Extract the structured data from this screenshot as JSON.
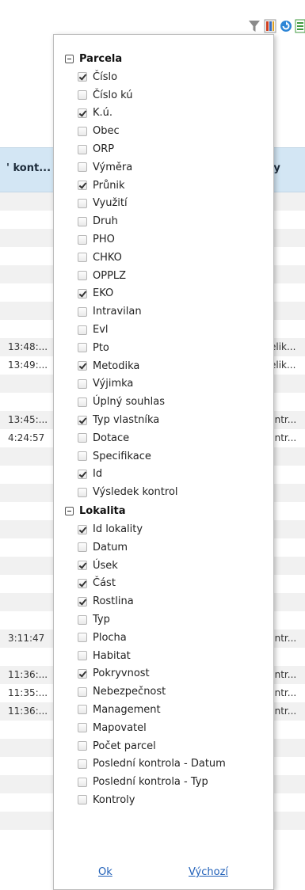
{
  "toolbar": {
    "icons": [
      "filter-icon",
      "columns-icon",
      "refresh-icon",
      "export-icon"
    ]
  },
  "table": {
    "header_left": "' kont...",
    "header_right": "oly",
    "rows": [
      {
        "left": "",
        "right": ""
      },
      {
        "left": "",
        "right": ""
      },
      {
        "left": "",
        "right": ""
      },
      {
        "left": "",
        "right": ""
      },
      {
        "left": "",
        "right": ""
      },
      {
        "left": "",
        "right": ""
      },
      {
        "left": "",
        "right": ""
      },
      {
        "left": "",
        "right": ""
      },
      {
        "left": "13:48:...",
        "right": "Nelik..."
      },
      {
        "left": "13:49:...",
        "right": "Nelik..."
      },
      {
        "left": "",
        "right": ""
      },
      {
        "left": "",
        "right": ""
      },
      {
        "left": "13:45:...",
        "right": "Kontr..."
      },
      {
        "left": "4:24:57",
        "right": "Kontr..."
      },
      {
        "left": "",
        "right": ""
      },
      {
        "left": "",
        "right": ""
      },
      {
        "left": "",
        "right": ""
      },
      {
        "left": "",
        "right": ""
      },
      {
        "left": "",
        "right": ""
      },
      {
        "left": "",
        "right": ""
      },
      {
        "left": "",
        "right": ""
      },
      {
        "left": "",
        "right": ""
      },
      {
        "left": "",
        "right": ""
      },
      {
        "left": "",
        "right": ""
      },
      {
        "left": "3:11:47",
        "right": "Kontr..."
      },
      {
        "left": "",
        "right": ""
      },
      {
        "left": "11:36:...",
        "right": "Kontr..."
      },
      {
        "left": "11:35:...",
        "right": "Kontr..."
      },
      {
        "left": "11:36:...",
        "right": "Kontr..."
      },
      {
        "left": "",
        "right": ""
      },
      {
        "left": "",
        "right": ""
      },
      {
        "left": "",
        "right": ""
      },
      {
        "left": "",
        "right": ""
      },
      {
        "left": "",
        "right": ""
      },
      {
        "left": "",
        "right": ""
      }
    ]
  },
  "panel": {
    "groups": [
      {
        "label": "Parcela",
        "items": [
          {
            "label": "Číslo",
            "checked": true
          },
          {
            "label": "Číslo kú",
            "checked": false
          },
          {
            "label": "K.ú.",
            "checked": true
          },
          {
            "label": "Obec",
            "checked": false
          },
          {
            "label": "ORP",
            "checked": false
          },
          {
            "label": "Výměra",
            "checked": false
          },
          {
            "label": "Průnik",
            "checked": true
          },
          {
            "label": "Využití",
            "checked": false
          },
          {
            "label": "Druh",
            "checked": false
          },
          {
            "label": "PHO",
            "checked": false
          },
          {
            "label": "CHKO",
            "checked": false
          },
          {
            "label": "OPPLZ",
            "checked": false
          },
          {
            "label": "EKO",
            "checked": true
          },
          {
            "label": "Intravilan",
            "checked": false
          },
          {
            "label": "Evl",
            "checked": false
          },
          {
            "label": "Pto",
            "checked": false
          },
          {
            "label": "Metodika",
            "checked": true
          },
          {
            "label": "Výjimka",
            "checked": false
          },
          {
            "label": "Úplný souhlas",
            "checked": false
          },
          {
            "label": "Typ vlastníka",
            "checked": true
          },
          {
            "label": "Dotace",
            "checked": false
          },
          {
            "label": "Specifikace",
            "checked": false
          },
          {
            "label": "Id",
            "checked": true
          },
          {
            "label": "Výsledek kontrol",
            "checked": false
          }
        ]
      },
      {
        "label": "Lokalita",
        "items": [
          {
            "label": "Id lokality",
            "checked": true
          },
          {
            "label": "Datum",
            "checked": false
          },
          {
            "label": "Úsek",
            "checked": true
          },
          {
            "label": "Část",
            "checked": true
          },
          {
            "label": "Rostlina",
            "checked": true
          },
          {
            "label": "Typ",
            "checked": false
          },
          {
            "label": "Plocha",
            "checked": false
          },
          {
            "label": "Habitat",
            "checked": false
          },
          {
            "label": "Pokryvnost",
            "checked": true
          },
          {
            "label": "Nebezpečnost",
            "checked": false
          },
          {
            "label": "Management",
            "checked": false
          },
          {
            "label": "Mapovatel",
            "checked": false
          },
          {
            "label": "Počet parcel",
            "checked": false
          },
          {
            "label": "Poslední kontrola - Datum",
            "checked": false
          },
          {
            "label": "Poslední kontrola - Typ",
            "checked": false
          },
          {
            "label": "Kontroly",
            "checked": false
          }
        ]
      }
    ],
    "ok_label": "Ok",
    "default_label": "Výchozí"
  }
}
